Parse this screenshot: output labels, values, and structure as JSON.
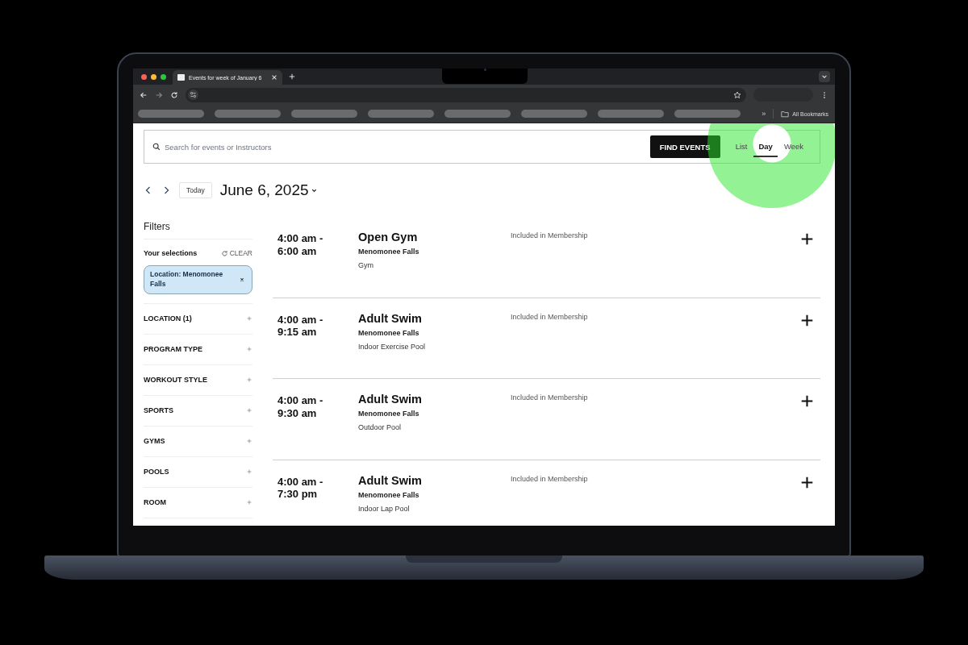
{
  "browser": {
    "tab_title": "Events for week of January 6",
    "bookmarks_more": "»",
    "bookmarks_folder": "All Bookmarks"
  },
  "search": {
    "placeholder": "Search for events or Instructors",
    "button": "FIND EVENTS"
  },
  "views": [
    {
      "label": "List",
      "selected": false
    },
    {
      "label": "Day",
      "selected": true
    },
    {
      "label": "Week",
      "selected": false
    }
  ],
  "date_nav": {
    "today": "Today",
    "date": "June 6, 2025"
  },
  "filters": {
    "title": "Filters",
    "selections_label": "Your selections",
    "clear": "CLEAR",
    "chips": [
      {
        "label": "Location: Menomonee Falls"
      }
    ],
    "groups": [
      "LOCATION (1)",
      "PROGRAM TYPE",
      "WORKOUT STYLE",
      "SPORTS",
      "GYMS",
      "POOLS",
      "ROOM"
    ]
  },
  "events": [
    {
      "time": "4:00 am - 6:00 am",
      "title": "Open Gym",
      "location": "Menomonee Falls",
      "room": "Gym",
      "price": "Included in Membership"
    },
    {
      "time": "4:00 am - 9:15 am",
      "title": "Adult Swim",
      "location": "Menomonee Falls",
      "room": "Indoor Exercise Pool",
      "price": "Included in Membership"
    },
    {
      "time": "4:00 am - 9:30 am",
      "title": "Adult Swim",
      "location": "Menomonee Falls",
      "room": "Outdoor Pool",
      "price": "Included in Membership"
    },
    {
      "time": "4:00 am - 7:30 pm",
      "title": "Adult Swim",
      "location": "Menomonee Falls",
      "room": "Indoor Lap Pool",
      "price": "Included in Membership"
    }
  ]
}
